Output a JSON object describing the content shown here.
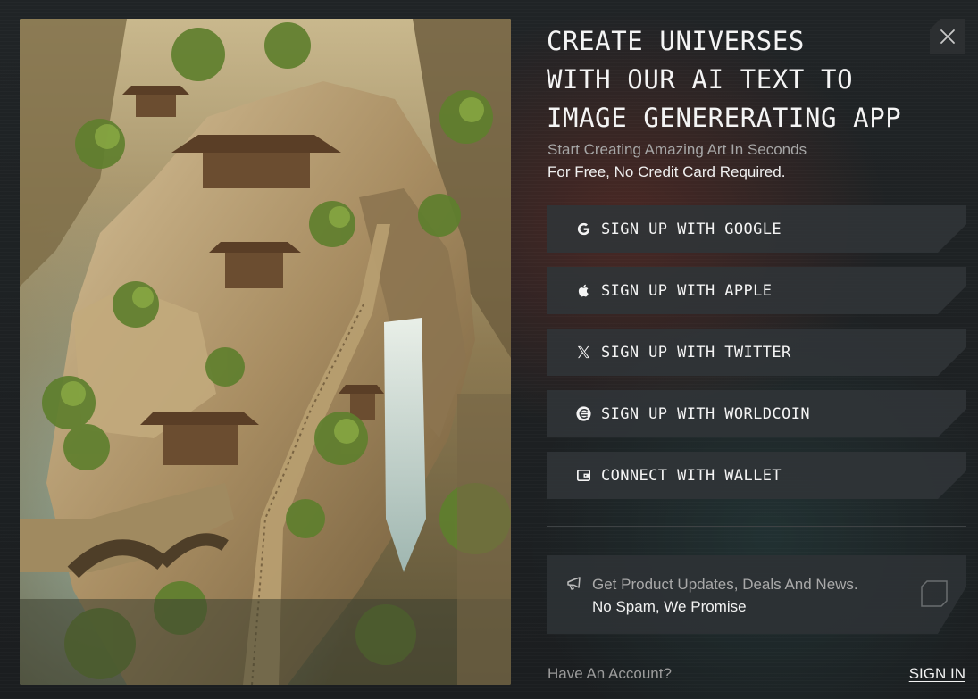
{
  "hero": {
    "image": "miniature-mountain-temple-waterfall"
  },
  "headline": {
    "lines": [
      "CREATE UNIVERSES",
      "WITH OUR AI TEXT TO",
      "IMAGE GENERERATING APP"
    ]
  },
  "subheadline": {
    "line1": "Start Creating Amazing Art In Seconds",
    "line2": "For Free, No Credit Card Required."
  },
  "close": {
    "icon": "close-icon"
  },
  "auth_buttons": [
    {
      "label": "SIGN UP WITH GOOGLE",
      "icon": "google-icon"
    },
    {
      "label": "SIGN UP WITH APPLE",
      "icon": "apple-icon"
    },
    {
      "label": "SIGN UP WITH TWITTER",
      "icon": "x-twitter-icon"
    },
    {
      "label": "SIGN UP WITH WORLDCOIN",
      "icon": "worldcoin-icon"
    },
    {
      "label": "CONNECT WITH WALLET",
      "icon": "wallet-icon"
    }
  ],
  "promo": {
    "icon": "megaphone-icon",
    "line1": "Get Product Updates, Deals And News.",
    "line2": "No Spam, We Promise",
    "checked": false
  },
  "footer": {
    "question": "Have An Account?",
    "sign_in": "SIGN IN"
  },
  "colors": {
    "background": "#1d2022",
    "button_bg": "#303437",
    "text": "#f4f4f4",
    "muted": "#a6a6a6"
  }
}
